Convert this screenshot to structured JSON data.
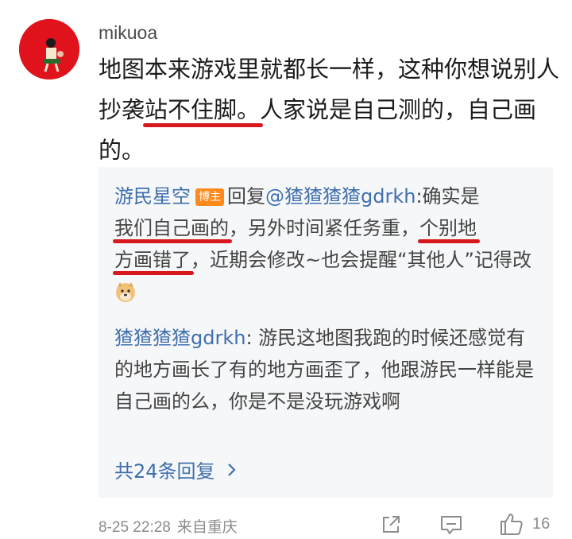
{
  "comment": {
    "username": "mikuoa",
    "text_parts": {
      "before": "地图本来游戏里就都长一样，这种你想说别人抄袭",
      "underlined": "站不住脚。",
      "after": "人家说是自己测的，自己画的。"
    }
  },
  "replies": [
    {
      "author": "游民星空",
      "badge": "博主",
      "reply_word": "回复",
      "mention": "@猹猹猹猹gdrkh",
      "colon": ":确实是",
      "underlined_1": "我们自己画的",
      "middle": "，另外时间紧任务重，",
      "underlined_2": "个别地",
      "underlined_3": "方画错了",
      "after": "，近期会修改~也会提醒“其他人”记得改",
      "emoji": "doge-emoji"
    },
    {
      "author": "猹猹猹猹gdrkh",
      "colon": ": ",
      "text": "游民这地图我跑的时候还感觉有的地方画长了有的地方画歪了，他跟游民一样能是自己画的么，你是不是没玩游戏啊"
    }
  ],
  "more_replies": "共24条回复",
  "footer": {
    "time": "8-25 22:28",
    "location": "来自重庆",
    "like_count": "16"
  },
  "icons": [
    "share-icon",
    "comment-icon",
    "like-icon",
    "chevron-right-icon"
  ],
  "colors": {
    "link": "#3f6fad",
    "badge": "#ff8a1c",
    "underline": "#d7181c",
    "avatar": "#e0131d"
  }
}
